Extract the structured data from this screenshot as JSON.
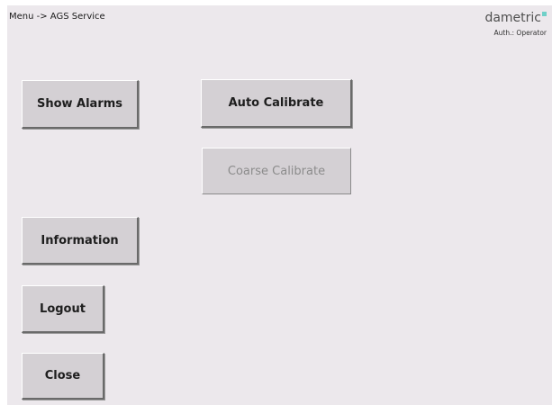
{
  "header": {
    "breadcrumb": "Menu -> AGS Service",
    "brand": "dametric",
    "auth": "Auth.: Operator"
  },
  "buttons": {
    "show_alarms": "Show Alarms",
    "auto_calibrate": "Auto Calibrate",
    "coarse_calibrate": "Coarse Calibrate",
    "information": "Information",
    "logout": "Logout",
    "close": "Close"
  },
  "colors": {
    "background": "#ece8ec",
    "button_face": "#d4d0d4",
    "brand_accent": "#6fd0c8",
    "disabled_text": "#8c8c8c"
  }
}
